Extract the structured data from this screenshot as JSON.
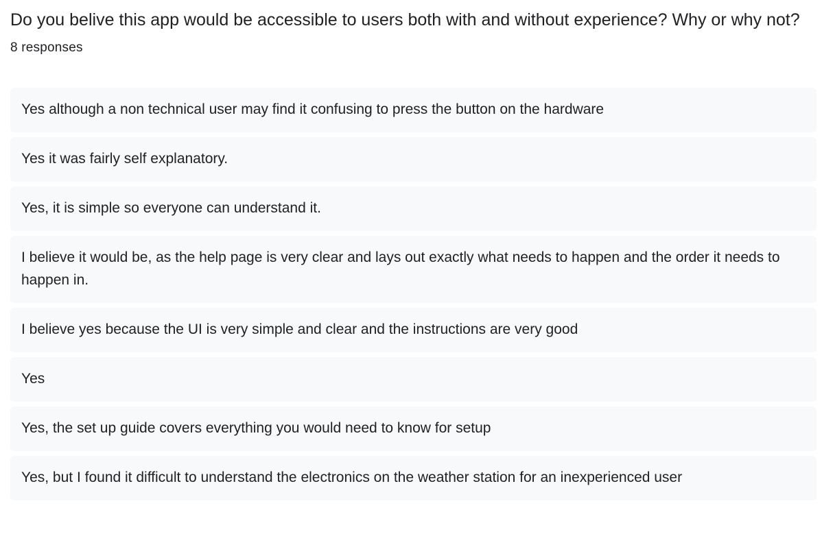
{
  "question": {
    "title": "Do you belive this app would be accessible to users both with and without experience? Why or why not?",
    "response_count": "8 responses"
  },
  "responses": [
    "Yes although a non technical user may find it confusing to press the button on the hardware",
    "Yes it was fairly self explanatory.",
    "Yes, it is simple so everyone can understand it.",
    "I believe it would be, as the help page is very clear and lays out exactly what needs to happen and the order it needs to happen in.",
    "I believe yes because the UI is very simple and clear and the instructions are very good",
    "Yes",
    "Yes, the set up guide covers everything you would need to know for setup",
    "Yes, but I found it difficult to understand the electronics on the weather station for an inexperienced user"
  ],
  "colors": {
    "text": "#202124",
    "response_background": "#f8f9fa",
    "page_background": "#ffffff"
  }
}
